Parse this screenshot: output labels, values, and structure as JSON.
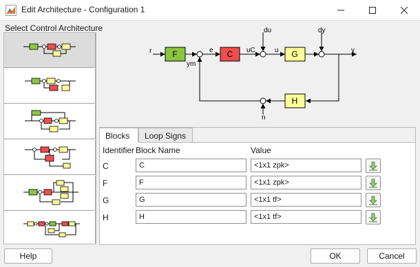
{
  "window": {
    "title": "Edit Architecture - Configuration 1",
    "icons": [
      "matlab-app-icon",
      "minimize-icon",
      "maximize-icon",
      "close-icon"
    ]
  },
  "sidebar": {
    "label": "Select Control Architecture",
    "selected_index": 0,
    "item_count": 6
  },
  "diagram": {
    "signals": [
      "r",
      "e",
      "uC",
      "u",
      "y",
      "du",
      "dy",
      "ym",
      "n"
    ],
    "blocks": [
      "F",
      "C",
      "G",
      "H"
    ],
    "colors": {
      "F": "#8cc63f",
      "C": "#f04e4e",
      "G": "#ffff99",
      "H": "#ffff99"
    }
  },
  "tabs": [
    {
      "label": "Blocks",
      "selected": true
    },
    {
      "label": "Loop Signs",
      "selected": false
    }
  ],
  "table": {
    "headers": {
      "identifier": "Identifier",
      "name": "Block Name",
      "value": "Value"
    },
    "rows": [
      {
        "id": "C",
        "name": "C",
        "value": "<1x1 zpk>"
      },
      {
        "id": "F",
        "name": "F",
        "value": "<1x1 zpk>"
      },
      {
        "id": "G",
        "name": "G",
        "value": "<1x1 tf>"
      },
      {
        "id": "H",
        "name": "H",
        "value": "<1x1 tf>"
      }
    ],
    "import_icon": "import-arrow-icon"
  },
  "buttons": {
    "help": "Help",
    "ok": "OK",
    "cancel": "Cancel"
  }
}
